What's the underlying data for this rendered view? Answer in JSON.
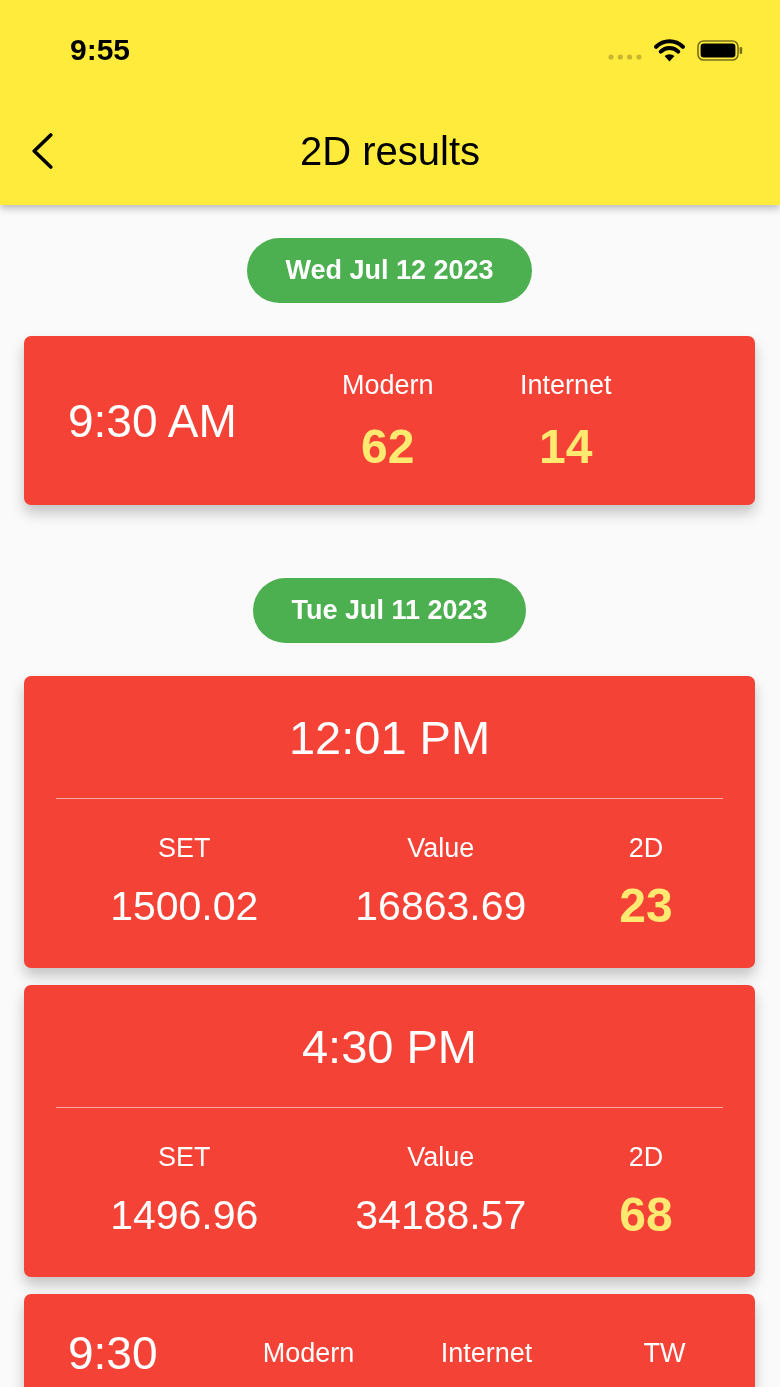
{
  "status_bar": {
    "time": "9:55"
  },
  "app_bar": {
    "title": "2D results"
  },
  "sections": [
    {
      "date": "Wed Jul 12 2023",
      "cards": [
        {
          "kind": "draw",
          "time": "9:30 AM",
          "columns": [
            {
              "label": "Modern",
              "value": "62",
              "highlighted": true
            },
            {
              "label": "Internet",
              "value": "14",
              "highlighted": true
            }
          ]
        }
      ]
    },
    {
      "date": "Tue Jul 11 2023",
      "cards": [
        {
          "kind": "result",
          "time": "12:01 PM",
          "columns": [
            {
              "label": "SET",
              "value": "1500.02",
              "highlighted": false
            },
            {
              "label": "Value",
              "value": "16863.69",
              "highlighted": false
            },
            {
              "label": "2D",
              "value": "23",
              "highlighted": true
            }
          ]
        },
        {
          "kind": "result",
          "time": "4:30 PM",
          "columns": [
            {
              "label": "SET",
              "value": "1496.96",
              "highlighted": false
            },
            {
              "label": "Value",
              "value": "34188.57",
              "highlighted": false
            },
            {
              "label": "2D",
              "value": "68",
              "highlighted": true
            }
          ]
        },
        {
          "kind": "draw",
          "time": "9:30",
          "columns": [
            {
              "label": "Modern"
            },
            {
              "label": "Internet"
            },
            {
              "label": "TW"
            }
          ]
        }
      ]
    }
  ]
}
